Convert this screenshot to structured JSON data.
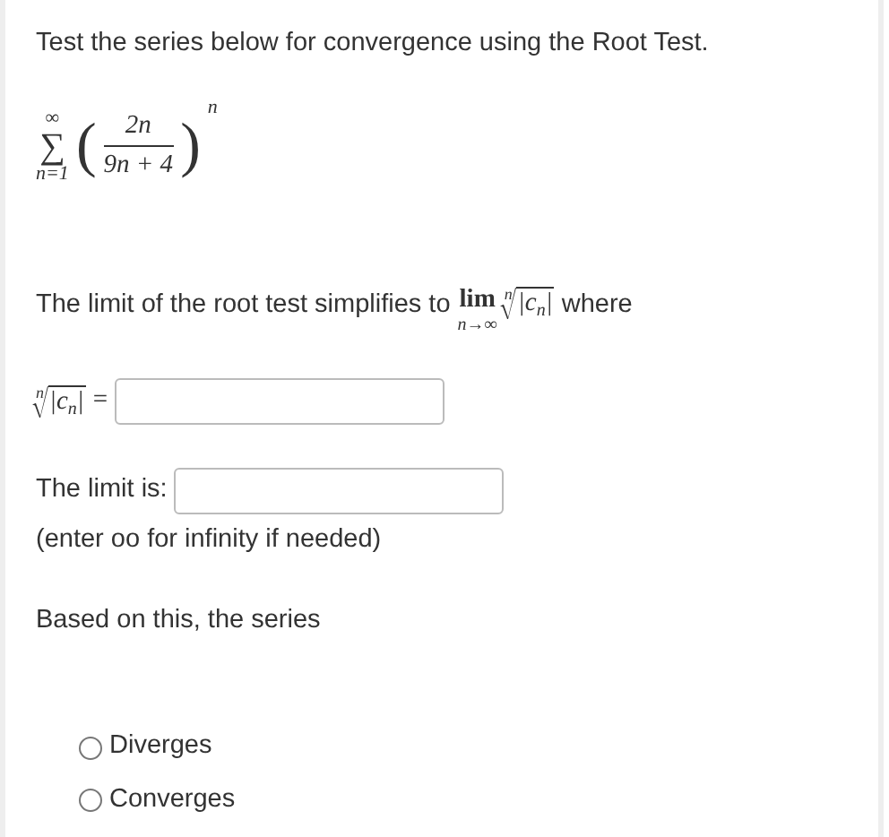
{
  "instruction": "Test the series below for convergence using the Root Test.",
  "series": {
    "sum_symbol": "∑",
    "upper": "∞",
    "lower": "n=1",
    "left_paren": "(",
    "numerator": "2n",
    "denominator": "9n + 4",
    "right_paren": ")",
    "exponent": "n"
  },
  "limit_sentence": {
    "text_before": "The limit of the root test simplifies to",
    "lim": "lim",
    "lim_subscript": "n→∞",
    "root_index": "n",
    "radicand": "|c$_{n}$|",
    "text_after": "where"
  },
  "root_expression": {
    "root_index": "n",
    "radicand": "|c$_{n}$|",
    "equals": "="
  },
  "limit_label": "The limit is:",
  "limit_hint": "(enter oo for infinity if needed)",
  "conclusion_prompt": "Based on this, the series",
  "options": [
    {
      "label": "Diverges",
      "selected": false
    },
    {
      "label": "Converges",
      "selected": false
    }
  ]
}
